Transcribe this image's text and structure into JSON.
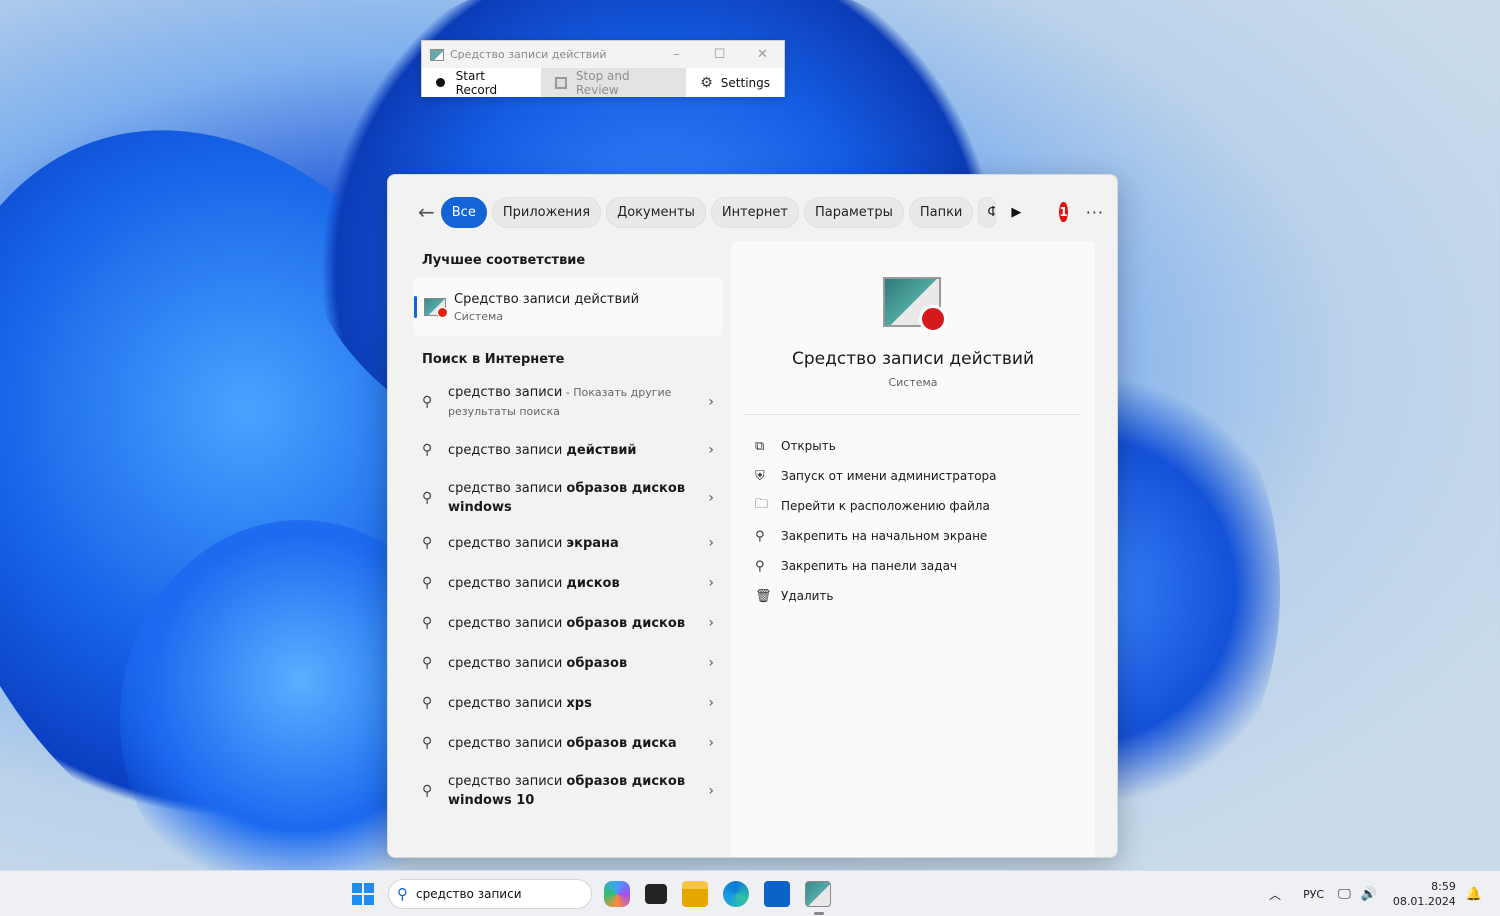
{
  "recorder": {
    "title": "Средство записи действий",
    "start_label": "Start Record",
    "stop_label": "Stop and Review",
    "settings_label": "Settings"
  },
  "search": {
    "filters": [
      "Все",
      "Приложения",
      "Документы",
      "Интернет",
      "Параметры",
      "Папки",
      "Ф"
    ],
    "best_match_heading": "Лучшее соответствие",
    "best_match": {
      "title": "Средство записи действий",
      "subtitle": "Система"
    },
    "web_heading": "Поиск в Интернете",
    "web_results": [
      {
        "prefix": "средство записи",
        "bold": "",
        "sub": " - Показать другие результаты поиска"
      },
      {
        "prefix": "средство записи ",
        "bold": "действий",
        "sub": ""
      },
      {
        "prefix": "средство записи ",
        "bold": "образов дисков windows",
        "sub": ""
      },
      {
        "prefix": "средство записи ",
        "bold": "экрана",
        "sub": ""
      },
      {
        "prefix": "средство записи ",
        "bold": "дисков",
        "sub": ""
      },
      {
        "prefix": "средство записи ",
        "bold": "образов дисков",
        "sub": ""
      },
      {
        "prefix": "средство записи ",
        "bold": "образов",
        "sub": ""
      },
      {
        "prefix": "средство записи ",
        "bold": "xps",
        "sub": ""
      },
      {
        "prefix": "средство записи ",
        "bold": "образов диска",
        "sub": ""
      },
      {
        "prefix": "средство записи ",
        "bold": "образов дисков windows 10",
        "sub": ""
      }
    ],
    "detail": {
      "title": "Средство записи действий",
      "subtitle": "Система",
      "actions": [
        {
          "icon": "open-icon",
          "label": "Открыть"
        },
        {
          "icon": "shield-icon",
          "label": "Запуск от имени администратора"
        },
        {
          "icon": "folder-icon",
          "label": "Перейти к расположению файла"
        },
        {
          "icon": "pin-icon",
          "label": "Закрепить на начальном экране"
        },
        {
          "icon": "pin-icon",
          "label": "Закрепить на панели задач"
        },
        {
          "icon": "trash-icon",
          "label": "Удалить"
        }
      ]
    },
    "badge": "1"
  },
  "taskbar": {
    "search_value": "средство записи",
    "lang": "РУС",
    "time": "8:59",
    "date": "08.01.2024"
  },
  "colors": {
    "accent": "#1364d6"
  }
}
